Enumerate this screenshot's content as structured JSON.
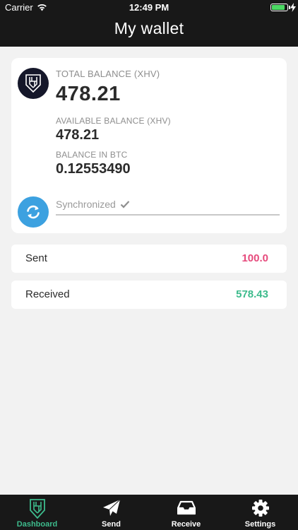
{
  "status_bar": {
    "carrier": "Carrier",
    "time": "12:49 PM",
    "battery_level": 0.9,
    "battery_color": "#4cd964"
  },
  "header": {
    "title": "My wallet"
  },
  "balance_card": {
    "logo_icon": "haven-logo-icon",
    "total_label": "TOTAL BALANCE (XHV)",
    "total_value": "478.21",
    "available_label": "AVAILABLE  BALANCE (XHV)",
    "available_value": "478.21",
    "btc_label": "BALANCE IN BTC",
    "btc_value": "0.12553490",
    "sync_icon": "refresh-icon",
    "sync_status": "Synchronized",
    "sync_check_icon": "checkmark-icon"
  },
  "transactions": {
    "sent_label": "Sent",
    "sent_value": "100.0",
    "sent_color": "#e64a7c",
    "received_label": "Received",
    "received_value": "578.43",
    "received_color": "#3dbb8c"
  },
  "tabbar": {
    "items": [
      {
        "label": "Dashboard",
        "icon": "haven-logo-icon",
        "active": true
      },
      {
        "label": "Send",
        "icon": "paper-plane-icon",
        "active": false
      },
      {
        "label": "Receive",
        "icon": "inbox-tray-icon",
        "active": false
      },
      {
        "label": "Settings",
        "icon": "gear-icon",
        "active": false
      }
    ],
    "active_color": "#3dbb8c"
  }
}
